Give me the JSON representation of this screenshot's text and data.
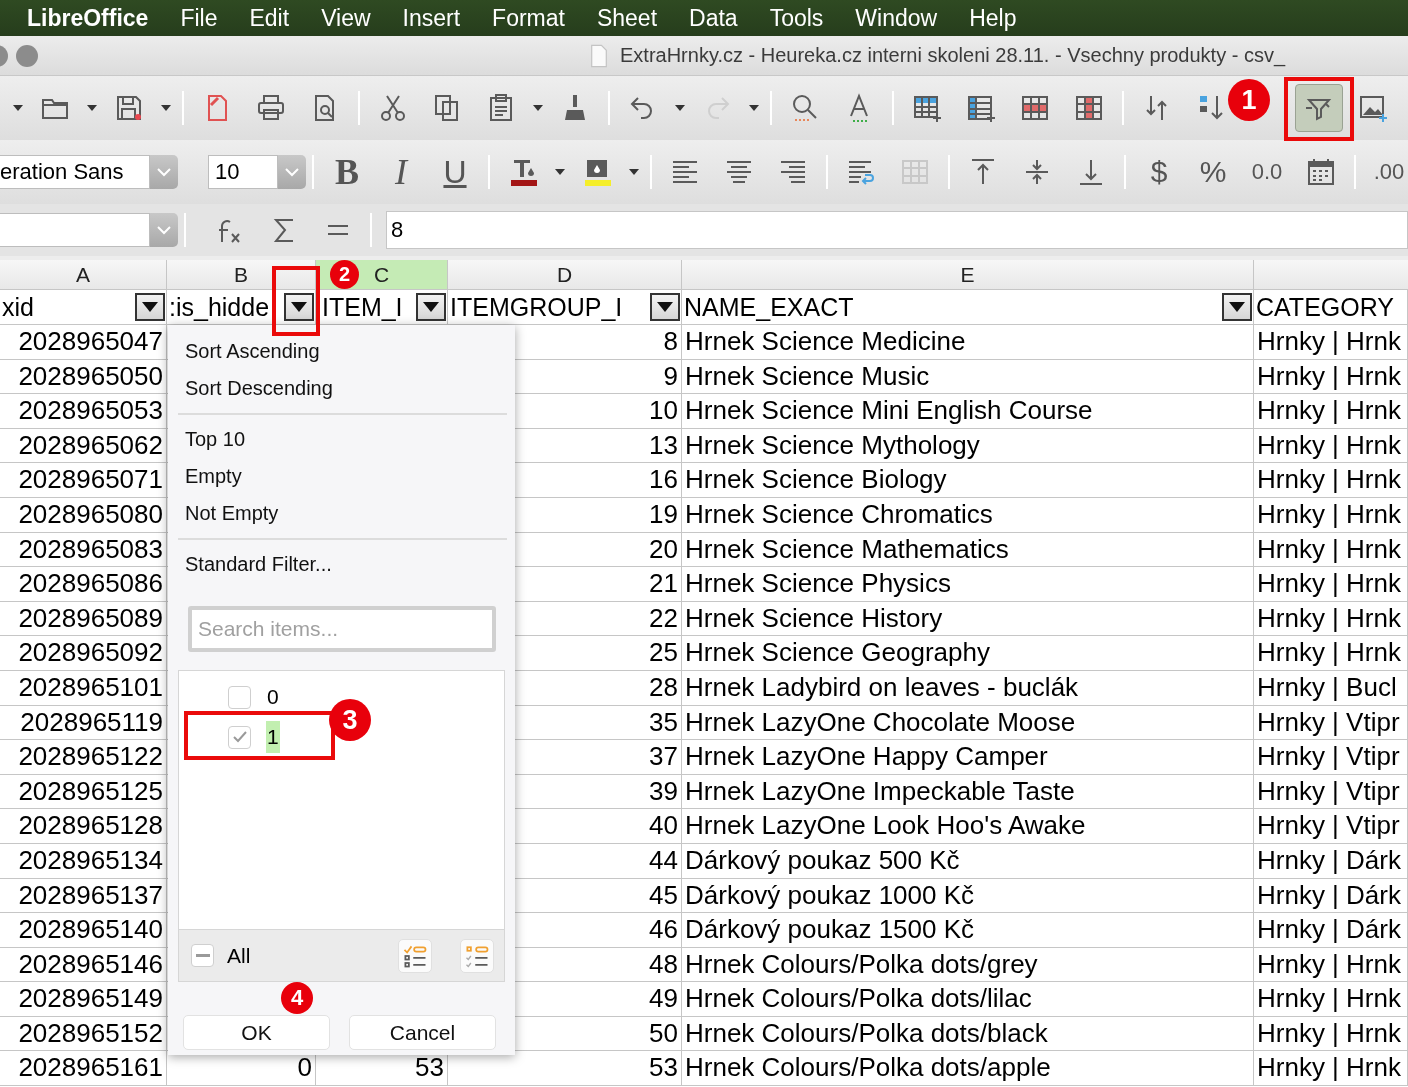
{
  "menu_bar": {
    "app_name": "LibreOffice",
    "items": [
      "File",
      "Edit",
      "View",
      "Insert",
      "Format",
      "Sheet",
      "Data",
      "Tools",
      "Window",
      "Help"
    ]
  },
  "window": {
    "title": "ExtraHrnky.cz - Heureka.cz interni skoleni 28.11. - Vsechny produkty - csv_"
  },
  "standard_toolbar": {
    "redo_disabled": true,
    "autofilter_pressed": true
  },
  "formatting_toolbar": {
    "font_name": "eration Sans",
    "font_size": "10",
    "style_buttons": [
      {
        "kind": "bold",
        "label": "B"
      },
      {
        "kind": "italic",
        "label": "I"
      },
      {
        "kind": "underline",
        "label": "U"
      }
    ],
    "merge_disabled": true,
    "number_buttons": [
      {
        "kind": "currency",
        "label": "$"
      },
      {
        "kind": "percent",
        "label": "%"
      },
      {
        "kind": "decimal",
        "label": "0.0"
      },
      {
        "kind": "date"
      },
      {
        "kind": "add_decimal",
        "label": ".00"
      }
    ]
  },
  "formula_bar": {
    "value": "8"
  },
  "columns": [
    {
      "letter": "A",
      "selected": false
    },
    {
      "letter": "B",
      "selected": false
    },
    {
      "letter": "C",
      "selected": true
    },
    {
      "letter": "D",
      "selected": false
    },
    {
      "letter": "E",
      "selected": false
    }
  ],
  "header_row": [
    {
      "label": "xid",
      "filter": true
    },
    {
      "label": ":is_hidde",
      "filter": true
    },
    {
      "label": "ITEM_I",
      "filter": true
    },
    {
      "label": "ITEMGROUP_I",
      "filter": true
    },
    {
      "label": "NAME_EXACT",
      "filter": true
    },
    {
      "label": "CATEGORY",
      "filter": false
    }
  ],
  "rows": [
    {
      "a": "2028965047",
      "d": "8",
      "e": "Hrnek Science Medicine",
      "f": "Hrnky | Hrnk"
    },
    {
      "a": "2028965050",
      "d": "9",
      "e": "Hrnek Science Music",
      "f": "Hrnky | Hrnk"
    },
    {
      "a": "2028965053",
      "d": "10",
      "e": "Hrnek Science Mini English Course",
      "f": "Hrnky | Hrnk"
    },
    {
      "a": "2028965062",
      "d": "13",
      "e": "Hrnek Science Mythology",
      "f": "Hrnky | Hrnk"
    },
    {
      "a": "2028965071",
      "d": "16",
      "e": "Hrnek Science Biology",
      "f": "Hrnky | Hrnk"
    },
    {
      "a": "2028965080",
      "d": "19",
      "e": "Hrnek Science Chromatics",
      "f": "Hrnky | Hrnk"
    },
    {
      "a": "2028965083",
      "d": "20",
      "e": "Hrnek Science Mathematics",
      "f": "Hrnky | Hrnk"
    },
    {
      "a": "2028965086",
      "d": "21",
      "e": "Hrnek Science Physics",
      "f": "Hrnky | Hrnk"
    },
    {
      "a": "2028965089",
      "d": "22",
      "e": "Hrnek Science History",
      "f": "Hrnky | Hrnk"
    },
    {
      "a": "2028965092",
      "d": "25",
      "e": "Hrnek Science Geography",
      "f": "Hrnky | Hrnk"
    },
    {
      "a": "2028965101",
      "d": "28",
      "e": "Hrnek Ladybird on leaves - buclák",
      "f": "Hrnky | Bucl"
    },
    {
      "a": "2028965119",
      "d": "35",
      "e": "Hrnek LazyOne Chocolate Moose",
      "f": "Hrnky | Vtipr"
    },
    {
      "a": "2028965122",
      "d": "37",
      "e": "Hrnek LazyOne Happy Camper",
      "f": "Hrnky | Vtipr"
    },
    {
      "a": "2028965125",
      "d": "39",
      "e": "Hrnek LazyOne Impeckable Taste",
      "f": "Hrnky | Vtipr"
    },
    {
      "a": "2028965128",
      "d": "40",
      "e": "Hrnek LazyOne Look Hoo's Awake",
      "f": "Hrnky | Vtipr"
    },
    {
      "a": "2028965134",
      "d": "44",
      "e": "Dárkový poukaz 500 Kč",
      "f": "Hrnky | Dárk"
    },
    {
      "a": "2028965137",
      "d": "45",
      "e": "Dárkový poukaz 1000 Kč",
      "f": "Hrnky | Dárk"
    },
    {
      "a": "2028965140",
      "d": "46",
      "e": "Dárkový poukaz 1500 Kč",
      "f": "Hrnky | Dárk"
    },
    {
      "a": "2028965146",
      "d": "48",
      "e": "Hrnek Colours/Polka dots/grey",
      "f": "Hrnky | Hrnk"
    },
    {
      "a": "2028965149",
      "d": "49",
      "e": "Hrnek Colours/Polka dots/lilac",
      "f": "Hrnky | Hrnk"
    },
    {
      "a": "2028965152",
      "d": "50",
      "e": "Hrnek Colours/Polka dots/black",
      "f": "Hrnky | Hrnk"
    },
    {
      "a": "2028965161",
      "b": "0",
      "c": "53",
      "d": "53",
      "e": "Hrnek Colours/Polka dots/apple",
      "f": "Hrnky | Hrnk"
    }
  ],
  "autofilter_popup": {
    "menu_groups": [
      [
        "Sort Ascending",
        "Sort Descending"
      ],
      [
        "Top 10",
        "Empty",
        "Not Empty"
      ],
      [
        "Standard Filter..."
      ]
    ],
    "search": {
      "placeholder": "Search items..."
    },
    "values": [
      {
        "label": "0",
        "checked": false,
        "selected": false
      },
      {
        "label": "1",
        "checked": true,
        "selected": true
      }
    ],
    "all": {
      "label": "All",
      "mixed": true
    },
    "buttons": [
      "OK",
      "Cancel"
    ]
  },
  "annotations": [
    {
      "number": "1"
    },
    {
      "number": "2"
    },
    {
      "number": "3"
    },
    {
      "number": "4"
    }
  ]
}
